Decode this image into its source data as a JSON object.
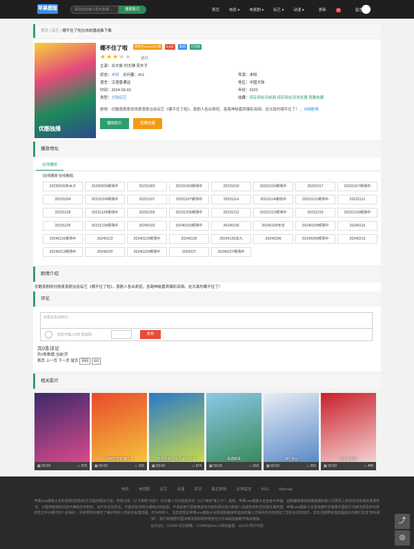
{
  "header": {
    "logo": "苹果模版",
    "search_placeholder": "请在此处输入影片名或...",
    "search_button": "搜索影片",
    "nav": [
      "首页",
      "电影 ▾",
      "电视剧 ▾",
      "综艺 ▾",
      "动漫 ▾",
      "更新",
      "留言"
    ],
    "update_badge": "0"
  },
  "breadcrumb": {
    "home": "首页",
    "sep1": "/",
    "cat": "综艺",
    "sep2": "/",
    "current": "绷不住了啦在线收播选集下载"
  },
  "detail": {
    "title": "绷不住了啦",
    "tags": [
      "更新至20240227期",
      "5.6分",
      "来源",
      "已完结"
    ],
    "tag_colors": [
      "#f39c12",
      "#e74c3c",
      "#3a8ee6",
      "#2e9e6e"
    ],
    "rating_label": "还行",
    "rating_stars": 3,
    "cast": "主演：合文俊 刘大锤 宋木子",
    "status_label": "状态：",
    "status_value": "未知",
    "views": "访问量：411",
    "director_label": "导演：",
    "director_value": "未知",
    "language": "语言：汉语普通话",
    "region": "地区：中国大陆",
    "time": "时间：2024-03-03",
    "year": "年份：2023",
    "genre_label": "类型：",
    "genre_value": "大陆综艺",
    "fav_label": "收藏：",
    "fav_links": [
      "保存网址到桌面",
      "保存网址到浏览器",
      "我要收藏"
    ],
    "desc_label": "剧情：",
    "desc": "优酷喜剧原创场景喜剧治愈综艺《绷不住了啦》，喜剧人各出奇招，各路神秘嘉宾爆彩亮相。这次真的绷不住了！",
    "desc_more": "... 详细剧情",
    "poster_tag": "优酷独播",
    "btn_play": "播放影片",
    "btn_fav": "我要收藏"
  },
  "play": {
    "heading": "播放地址",
    "tab": "在线播放",
    "source_title": "[在线播放-在线播放]",
    "episodes": [
      "20230926宋木子",
      "20230926候场中",
      "20231003",
      "20231003候场中",
      "20231010",
      "20231010候场中",
      "20231017",
      "20231017候场中",
      "20231024",
      "20231024候场中",
      "20231107",
      "20231107候场中",
      "20231114",
      "20231114候场中",
      "20231121候场中",
      "20231121",
      "20231128",
      "20231128候场中",
      "20231205",
      "20231205候场中",
      "20231212",
      "20231212候场中",
      "20231219",
      "20231219候场中",
      "20231226",
      "20231226候场中",
      "20240102",
      "20240102候场中",
      "20240109",
      "20240109专访",
      "20240109候场中",
      "20240116",
      "20240116候场中",
      "20240123",
      "20240123候场中",
      "20240130",
      "20240130关九",
      "20240206",
      "20240206候场中",
      "20240213",
      "20240213候场中",
      "20240220",
      "20240220候场中",
      "2024227",
      "20240227候场中"
    ]
  },
  "plot": {
    "heading": "剧情介绍",
    "text": "优酷喜剧原创场景喜剧治愈综艺《绷不住了啦》，喜剧人各出奇招，各路神秘嘉宾爆彩亮相。这次真的绷不住了！"
  },
  "comment": {
    "heading": "评论",
    "placeholder": "有要没事说两句...",
    "count_hint": "您还可输入200",
    "captcha_label": "验证码:",
    "submit": "发布",
    "total": "共0条评论",
    "pages": "共0条数据,当前/页",
    "pager": "首页 上一页 下一页 尾页",
    "page_input": "页码",
    "go": "GO"
  },
  "related": {
    "heading": "相关影片",
    "items": [
      {
        "title": "",
        "date": "03-03",
        "views": "878",
        "color1": "#3b2a6b",
        "color2": "#d84a8a"
      },
      {
        "title": "今晚开放麦 第二季",
        "date": "03-03",
        "views": "105",
        "color1": "#e84a2a",
        "color2": "#f5c23b"
      },
      {
        "title": "普通男的一日行 第十二季",
        "date": "03-03",
        "views": "574",
        "color1": "#2a7ac8",
        "color2": "#c8d84a"
      },
      {
        "title": "歌遇新歌",
        "date": "03-03",
        "views": "916",
        "color1": "#8cc8e8",
        "color2": "#3a8a5a"
      },
      {
        "title": "湘行漫记",
        "date": "03-03",
        "views": "360",
        "color1": "#e8eef5",
        "color2": "#5a8ac8"
      },
      {
        "title": "爱情保卫战",
        "date": "03-03",
        "views": "498",
        "color1": "#c8202a",
        "color2": "#f5d0d0"
      }
    ]
  },
  "footer": {
    "nav": [
      "电影",
      "电视剧",
      "综艺",
      "动漫",
      "资讯",
      "最近更新",
      "反馈留言",
      "RSS",
      "Sitemap"
    ],
    "disclaimer": "苹果cms模板大全影视通过抓取的方式提供相关内容。所有内容（以下简称\"内容\"）均为第三方内容提供方（以下简称\"第三方\"）提供。苹果cms模板大全自身不存储、控制编辑或修改被链接的第三方网页上的信息内容或其表现形式。对提供链接的内容不拥有任何权利，也不负任何责任。不提供任何明示或暗示的担保，不承担用户因使用这些内容资源对自己和他人造成任何形式的损失或伤害。苹果cms模板大全承诺遵守并尊重中国现行法律法规及所有规范性文件对著作权人的保护，并依照规定制定了保护权利人权利的处理流程。作为权利人，当您发现在苹果cms模板大全影视的链接所指向的第三方网页的内容侵犯了您的合法权益时，您应当按照处理流程首先向我们发送\"权利通知\"，我们将根据中国法律法规和政府规范性文件采取措施断开相关链接。",
    "contact": "站长QQ：123456 站长邮箱：123456@test.cn网站备案：icp123 统计代码"
  }
}
